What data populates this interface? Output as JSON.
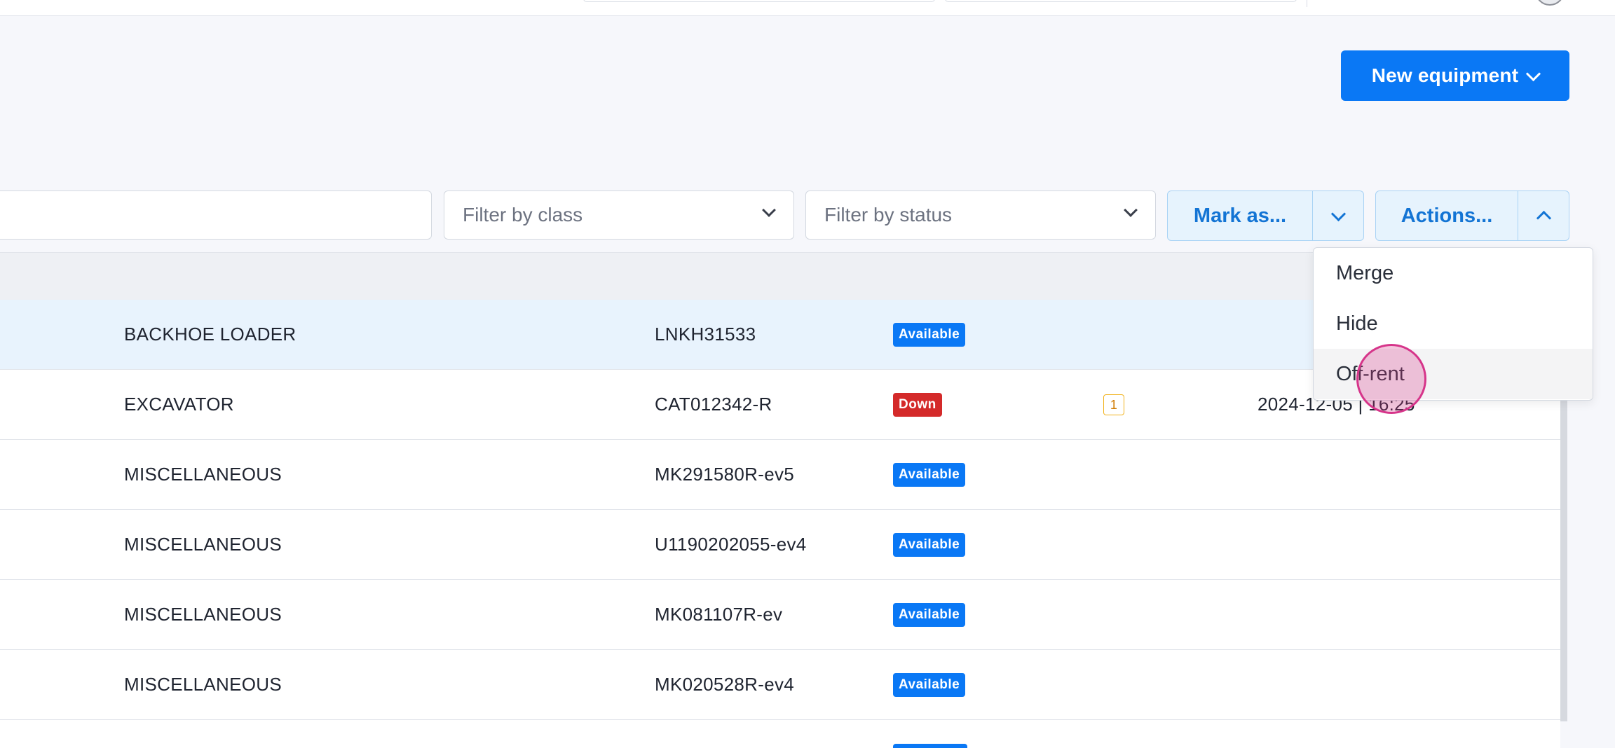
{
  "header": {
    "new_equipment_label": "New equipment"
  },
  "filters": {
    "search_value": "",
    "class_placeholder": "Filter by class",
    "status_placeholder": "Filter by status",
    "mark_as_label": "Mark as...",
    "actions_label": "Actions..."
  },
  "actions_menu": {
    "items": [
      {
        "label": "Merge"
      },
      {
        "label": "Hide"
      },
      {
        "label": "Off-rent"
      }
    ],
    "hovered": "Off-rent"
  },
  "table": {
    "rows": [
      {
        "class": "BACKHOE LOADER",
        "serial": "LNKH31533",
        "status": "Available",
        "count": "",
        "date": ""
      },
      {
        "class": "EXCAVATOR",
        "serial": "CAT012342-R",
        "status": "Down",
        "count": "1",
        "date": "2024-12-05 | 16:25"
      },
      {
        "class": "MISCELLANEOUS",
        "serial": "MK291580R-ev5",
        "status": "Available",
        "count": "",
        "date": ""
      },
      {
        "class": "MISCELLANEOUS",
        "serial": "U1190202055-ev4",
        "status": "Available",
        "count": "",
        "date": ""
      },
      {
        "class": "MISCELLANEOUS",
        "serial": "MK081107R-ev",
        "status": "Available",
        "count": "",
        "date": ""
      },
      {
        "class": "MISCELLANEOUS",
        "serial": "MK020528R-ev4",
        "status": "Available",
        "count": "",
        "date": ""
      }
    ]
  },
  "colors": {
    "primary": "#0a78f5",
    "status_available": "#0a78f5",
    "status_down": "#d42a2a",
    "count_badge": "#f1b21d",
    "cursor": "#d6358a"
  }
}
